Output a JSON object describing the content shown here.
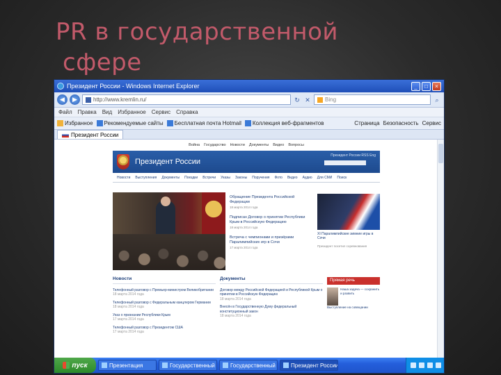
{
  "slide": {
    "title_line1": "PR в государственной",
    "title_line2": "сфере"
  },
  "window": {
    "title": "Президент России - Windows Internet Explorer",
    "controls": [
      "_",
      "□",
      "×"
    ]
  },
  "address_bar": {
    "url": "http://www.kremlin.ru/",
    "search_placeholder": "Bing",
    "back": "◀",
    "forward": "▶"
  },
  "menu": {
    "items": [
      "Файл",
      "Правка",
      "Вид",
      "Избранное",
      "Сервис",
      "Справка"
    ]
  },
  "favorites_bar": {
    "favorites_label": "Избранное",
    "items": [
      "Рекомендуемые сайты",
      "Бесплатная почта Hotmail",
      "Коллекция веб-фрагментов"
    ],
    "tools": [
      "Страница",
      "Безопасность",
      "Сервис"
    ]
  },
  "tab": {
    "label": "Президент России"
  },
  "site": {
    "name": "Президент России",
    "topnav": [
      "Война",
      "Государство",
      "Новости",
      "Документы",
      "Видео",
      "Вопросы"
    ],
    "header_right": [
      "Президент России",
      "RSS",
      "Eng"
    ],
    "nav": [
      "Новости",
      "Выступления",
      "Документы",
      "Поездки",
      "Встречи",
      "Указы",
      "Законы",
      "Поручения",
      "Фото",
      "Видео",
      "Аудио",
      "Для СМИ",
      "Поиск"
    ],
    "hero_news": [
      {
        "title": "Обращение Президента Российской Федерации",
        "date": "18 марта 2014 года"
      },
      {
        "title": "Подписан Договор о принятии Республики Крым в Российскую Федерацию",
        "date": "18 марта 2014 года"
      },
      {
        "title": "Встреча с чемпионами и призёрами Паралимпийских игр в Сочи",
        "date": "17 марта 2014 года"
      }
    ],
    "hero_side": {
      "caption": "XI Паралимпийские зимние игры в Сочи",
      "sub": "Президент посетил соревнования"
    },
    "columns": {
      "news_heading": "Новости",
      "news": [
        {
          "text": "Телефонный разговор с Премьер-министром Великобритании",
          "date": "18 марта 2014 года"
        },
        {
          "text": "Телефонный разговор с Федеральным канцлером Германии",
          "date": "18 марта 2014 года"
        },
        {
          "text": "Указ о признании Республики Крым",
          "date": "17 марта 2014 года"
        },
        {
          "text": "Телефонный разговор с Президентом США",
          "date": "17 марта 2014 года"
        }
      ],
      "docs_heading": "Документы",
      "docs": [
        {
          "text": "Договор между Российской Федерацией и Республикой Крым о принятии в Российскую Федерацию",
          "date": "18 марта 2014 года"
        },
        {
          "text": "Внесён в Государственную Думу федеральный конституционный закон",
          "date": "18 марта 2014 года"
        }
      ],
      "speech_heading": "Прямая речь",
      "speech_text": "Наша задача — сохранить и развить",
      "speech_sub": "Выступление на совещании"
    }
  },
  "taskbar": {
    "start": "пуск",
    "tasks": [
      "Презентация",
      "Государственный",
      "Государственный",
      "Президент России"
    ],
    "clock": ""
  }
}
